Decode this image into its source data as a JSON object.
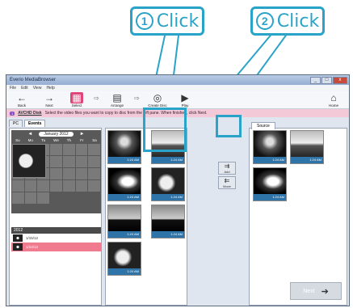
{
  "callouts": [
    {
      "number": "1",
      "label": "Click"
    },
    {
      "number": "2",
      "label": "Click"
    }
  ],
  "window": {
    "title": "Everio MediaBrowser",
    "controls": {
      "minimize": "_",
      "maximize": "□",
      "close": "x"
    }
  },
  "menu": [
    "File",
    "Edit",
    "View",
    "Help"
  ],
  "toolbar": {
    "tools": [
      {
        "label": "Back",
        "icon": "back-arrow-icon",
        "glyph": "←"
      },
      {
        "label": "Next",
        "icon": "forward-arrow-icon",
        "glyph": "→"
      },
      {
        "label": "Select",
        "icon": "select-icon",
        "glyph": "▦"
      },
      {
        "label": "Arrange",
        "icon": "arrange-icon",
        "glyph": "▤"
      },
      {
        "label": "Create Disc",
        "icon": "disc-icon",
        "glyph": "◎"
      },
      {
        "label": "Play",
        "icon": "play-icon",
        "glyph": "▶"
      }
    ],
    "home_label": "Home",
    "home_glyph": "⌂"
  },
  "infobar": {
    "badge": "1",
    "title": "AVCHD Disk",
    "text": "Select the video files you want to copy to disc from the left pane. When finished, click Next."
  },
  "tabs": [
    {
      "label": "PC"
    },
    {
      "label": "Events"
    }
  ],
  "calendar": {
    "title": "January 2012",
    "prev": "◄",
    "next": "►",
    "days_of_week": [
      "Su",
      "Mo",
      "Tu",
      "We",
      "Th",
      "Fr",
      "Sa"
    ]
  },
  "day_list": {
    "header": "2012",
    "rows": [
      {
        "label": "1/15/12"
      },
      {
        "label": "1/24/12"
      }
    ]
  },
  "thumbnails": [
    {
      "caption": "1:24 AM",
      "img": "a"
    },
    {
      "caption": "1:24 AM",
      "img": "b"
    },
    {
      "caption": "1:24 AM",
      "img": "c"
    },
    {
      "caption": "1:24 AM",
      "img": "e"
    },
    {
      "caption": "1:24 AM",
      "img": "d"
    },
    {
      "caption": "1:24 AM",
      "img": "d"
    },
    {
      "caption": "1:24 AM",
      "img": "e"
    }
  ],
  "side_buttons": [
    {
      "label": "Add",
      "glyph": "⇉"
    },
    {
      "label": "Move",
      "glyph": "⇇"
    }
  ],
  "select_panel": {
    "tab": "Source",
    "thumbnails": [
      {
        "caption": "1:24 AM",
        "img": "a"
      },
      {
        "caption": "1:24 AM",
        "img": "b"
      },
      {
        "caption": "1:24 AM",
        "img": "c"
      }
    ],
    "next_label": "Next",
    "next_glyph": "➔"
  },
  "colors": {
    "callout": "#2aa3c9",
    "selected_tool": "#e0457a",
    "selected_day": "#f07a8e",
    "caption_bar": "#2e74a8"
  }
}
